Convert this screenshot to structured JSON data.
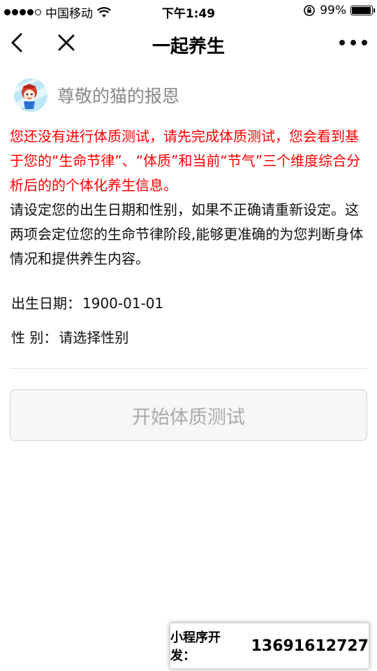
{
  "status_bar": {
    "carrier": "中国移动",
    "time": "下午1:49",
    "battery_percent_text": "99%",
    "battery_level": 0.99,
    "signal_bars_filled": 4,
    "signal_bars_total": 5,
    "icons": [
      "wifi-icon",
      "orientation-lock-icon",
      "battery-icon"
    ]
  },
  "nav": {
    "title": "一起养生",
    "back_icon": "chevron-left-icon",
    "close_icon": "close-icon",
    "more_icon": "more-dots-icon"
  },
  "user": {
    "name": "尊敬的猫的报恩"
  },
  "message": {
    "warning": "您还没有进行体质测试，请先完成体质测试，您会看到基于您的“生命节律”、“体质”和当前“节气”三个维度综合分析后的的个体化养生信息。",
    "instruction": "请设定您的出生日期和性别，如果不正确请重新设定。这两项会定位您的生命节律阶段,能够更准确的为您判断身体情况和提供养生内容。"
  },
  "form": {
    "dob_label": "出生日期：",
    "dob_value": "1900-01-01",
    "gender_label": "性 别：",
    "gender_value": "请选择性别"
  },
  "button": {
    "start_label": "开始体质测试"
  },
  "promo": {
    "label": "小程序开发：",
    "number": "13691612727"
  },
  "colors": {
    "warning_text": "#ff0000",
    "muted_text": "#888888",
    "button_text_disabled": "#a9a9a9"
  }
}
